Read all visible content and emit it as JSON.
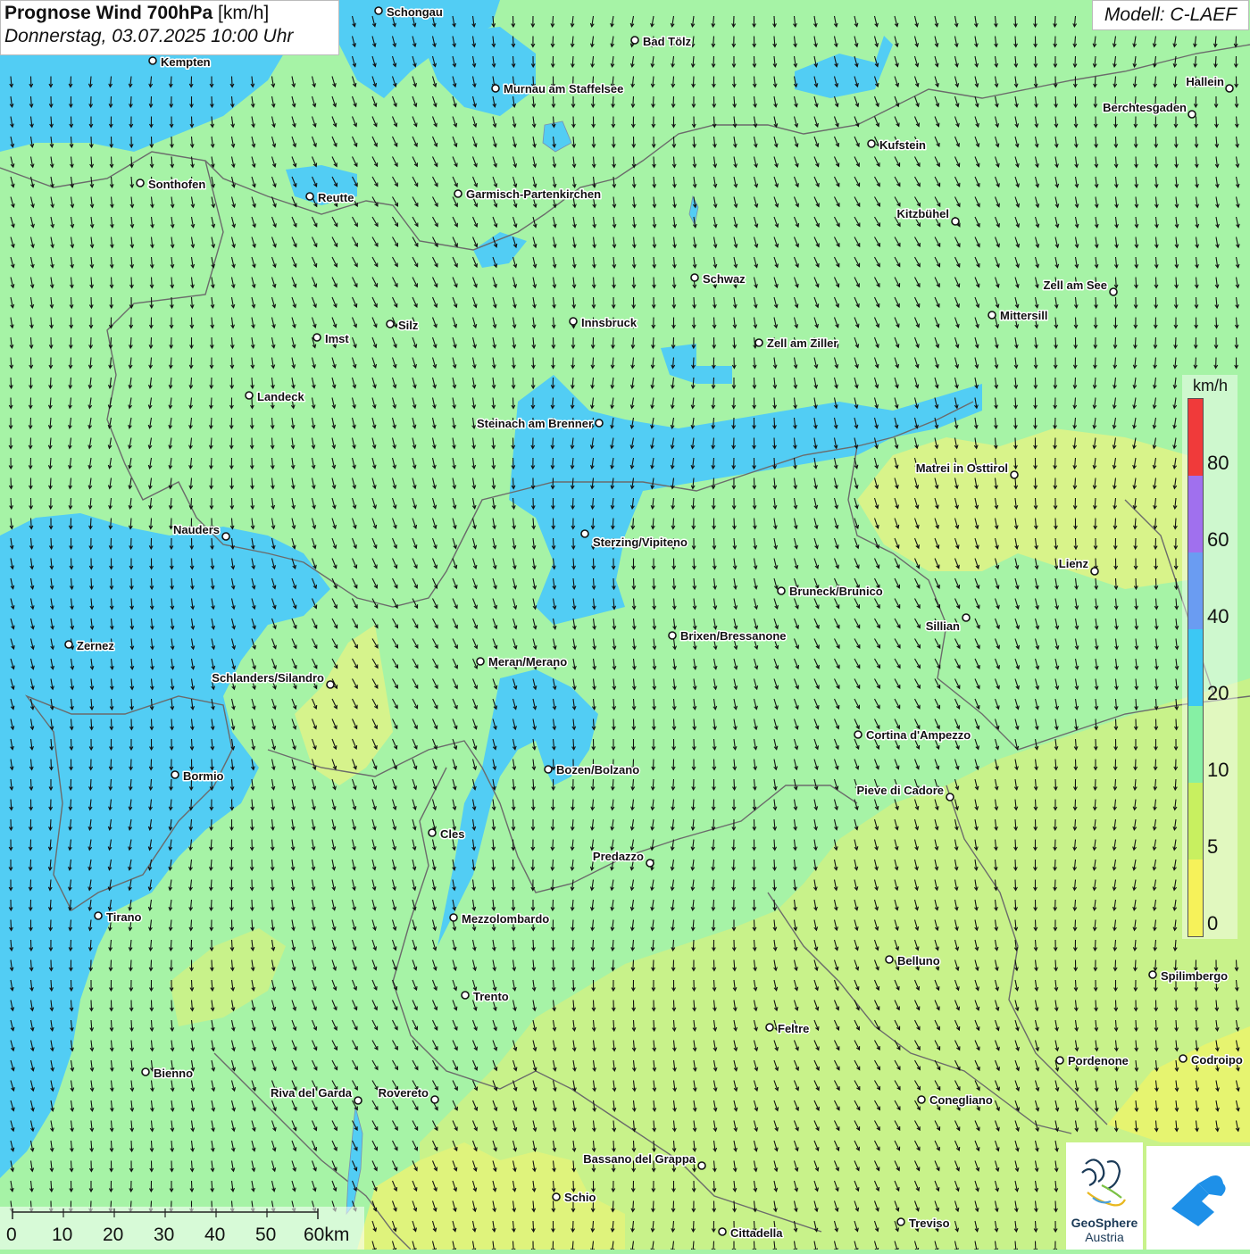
{
  "title": {
    "main_bold": "Prognose Wind 700hPa",
    "unit": "[km/h]",
    "datetime": "Donnerstag, 03.07.2025 10:00 Uhr"
  },
  "model_label": "Modell: C-LAEF",
  "legend": {
    "unit": "km/h",
    "ticks": [
      "80",
      "60",
      "40",
      "20",
      "10",
      "5",
      "0"
    ],
    "colors": [
      "#f03a3a",
      "#a070ee",
      "#6a9cf2",
      "#3cc8f4",
      "#86f0a4",
      "#c8f060",
      "#f6f25a"
    ]
  },
  "scalebar": {
    "labels": [
      "0",
      "10",
      "20",
      "30",
      "40",
      "50",
      "60km"
    ]
  },
  "logos": {
    "geosphere_line1": "GeoSphere",
    "geosphere_line2": "Austria"
  },
  "colors": {
    "wind_0_5": "#eef57a",
    "wind_5_10": "#c8f28a",
    "wind_10_20": "#a6f3a6",
    "wind_20_40": "#52cdf4",
    "arrow": "#111111",
    "border": "#6b6b6b"
  },
  "cities": [
    "Schongau",
    "Bad Tölz",
    "Kempten",
    "Murnau am Staffelsee",
    "Hallein",
    "Berchtesgaden",
    "Kufstein",
    "Sonthofen",
    "Reutte",
    "Garmisch-Partenkirchen",
    "Kitzbühel",
    "Schwaz",
    "Zell am See",
    "Mittersill",
    "Innsbruck",
    "Silz",
    "Imst",
    "Zell am Ziller",
    "Landeck",
    "Steinach am Brenner",
    "Matrei in Osttirol",
    "Nauders",
    "Sterzing/Vipiteno",
    "Lienz",
    "Bruneck/Brunico",
    "Sillian",
    "Brixen/Bressanone",
    "Zernez",
    "Meran/Merano",
    "Schlanders/Silandro",
    "Cortina d'Ampezzo",
    "Bormio",
    "Bozen/Bolzano",
    "Pieve di Cadore",
    "Cles",
    "Predazzo",
    "Tirano",
    "Mezzolombardo",
    "Belluno",
    "Spilimbergo",
    "Trento",
    "Feltre",
    "Pordenone",
    "Codroipo",
    "Bienno",
    "Riva del Garda",
    "Rovereto",
    "Conegliano",
    "Bassano del Grappa",
    "Schio",
    "Treviso",
    "Cittadella"
  ]
}
